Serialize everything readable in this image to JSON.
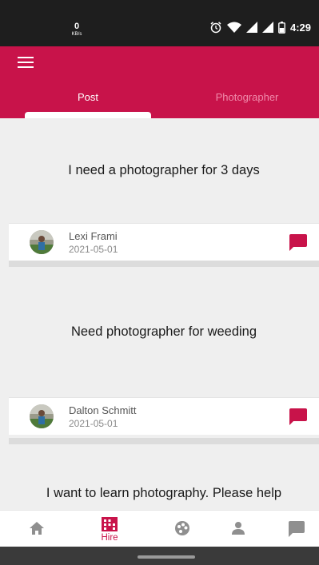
{
  "status_bar": {
    "net_speed_value": "0",
    "net_speed_unit": "KB/s",
    "time": "4:29",
    "icons": [
      "alarm-icon",
      "wifi-icon",
      "signal-icon",
      "signal-icon",
      "battery-icon"
    ]
  },
  "app_bar": {
    "menu_icon": "menu-icon",
    "tabs": [
      {
        "label": "Post",
        "active": true
      },
      {
        "label": "Photographer",
        "active": false
      }
    ],
    "color": "#c8134a"
  },
  "posts": [
    {
      "text": "I need a photographer for 3 days",
      "author": "Lexi Frami",
      "date": "2021-05-01"
    },
    {
      "text": "Need photographer for weeding",
      "author": "Dalton Schmitt",
      "date": "2021-05-01"
    },
    {
      "text": "I want to learn photography. Please help"
    }
  ],
  "bottom_nav": {
    "items": [
      {
        "icon": "home-icon",
        "label": ""
      },
      {
        "icon": "hire-icon",
        "label": "Hire",
        "active": true
      },
      {
        "icon": "palette-icon",
        "label": ""
      },
      {
        "icon": "person-icon",
        "label": ""
      },
      {
        "icon": "chat-icon",
        "label": ""
      }
    ]
  }
}
